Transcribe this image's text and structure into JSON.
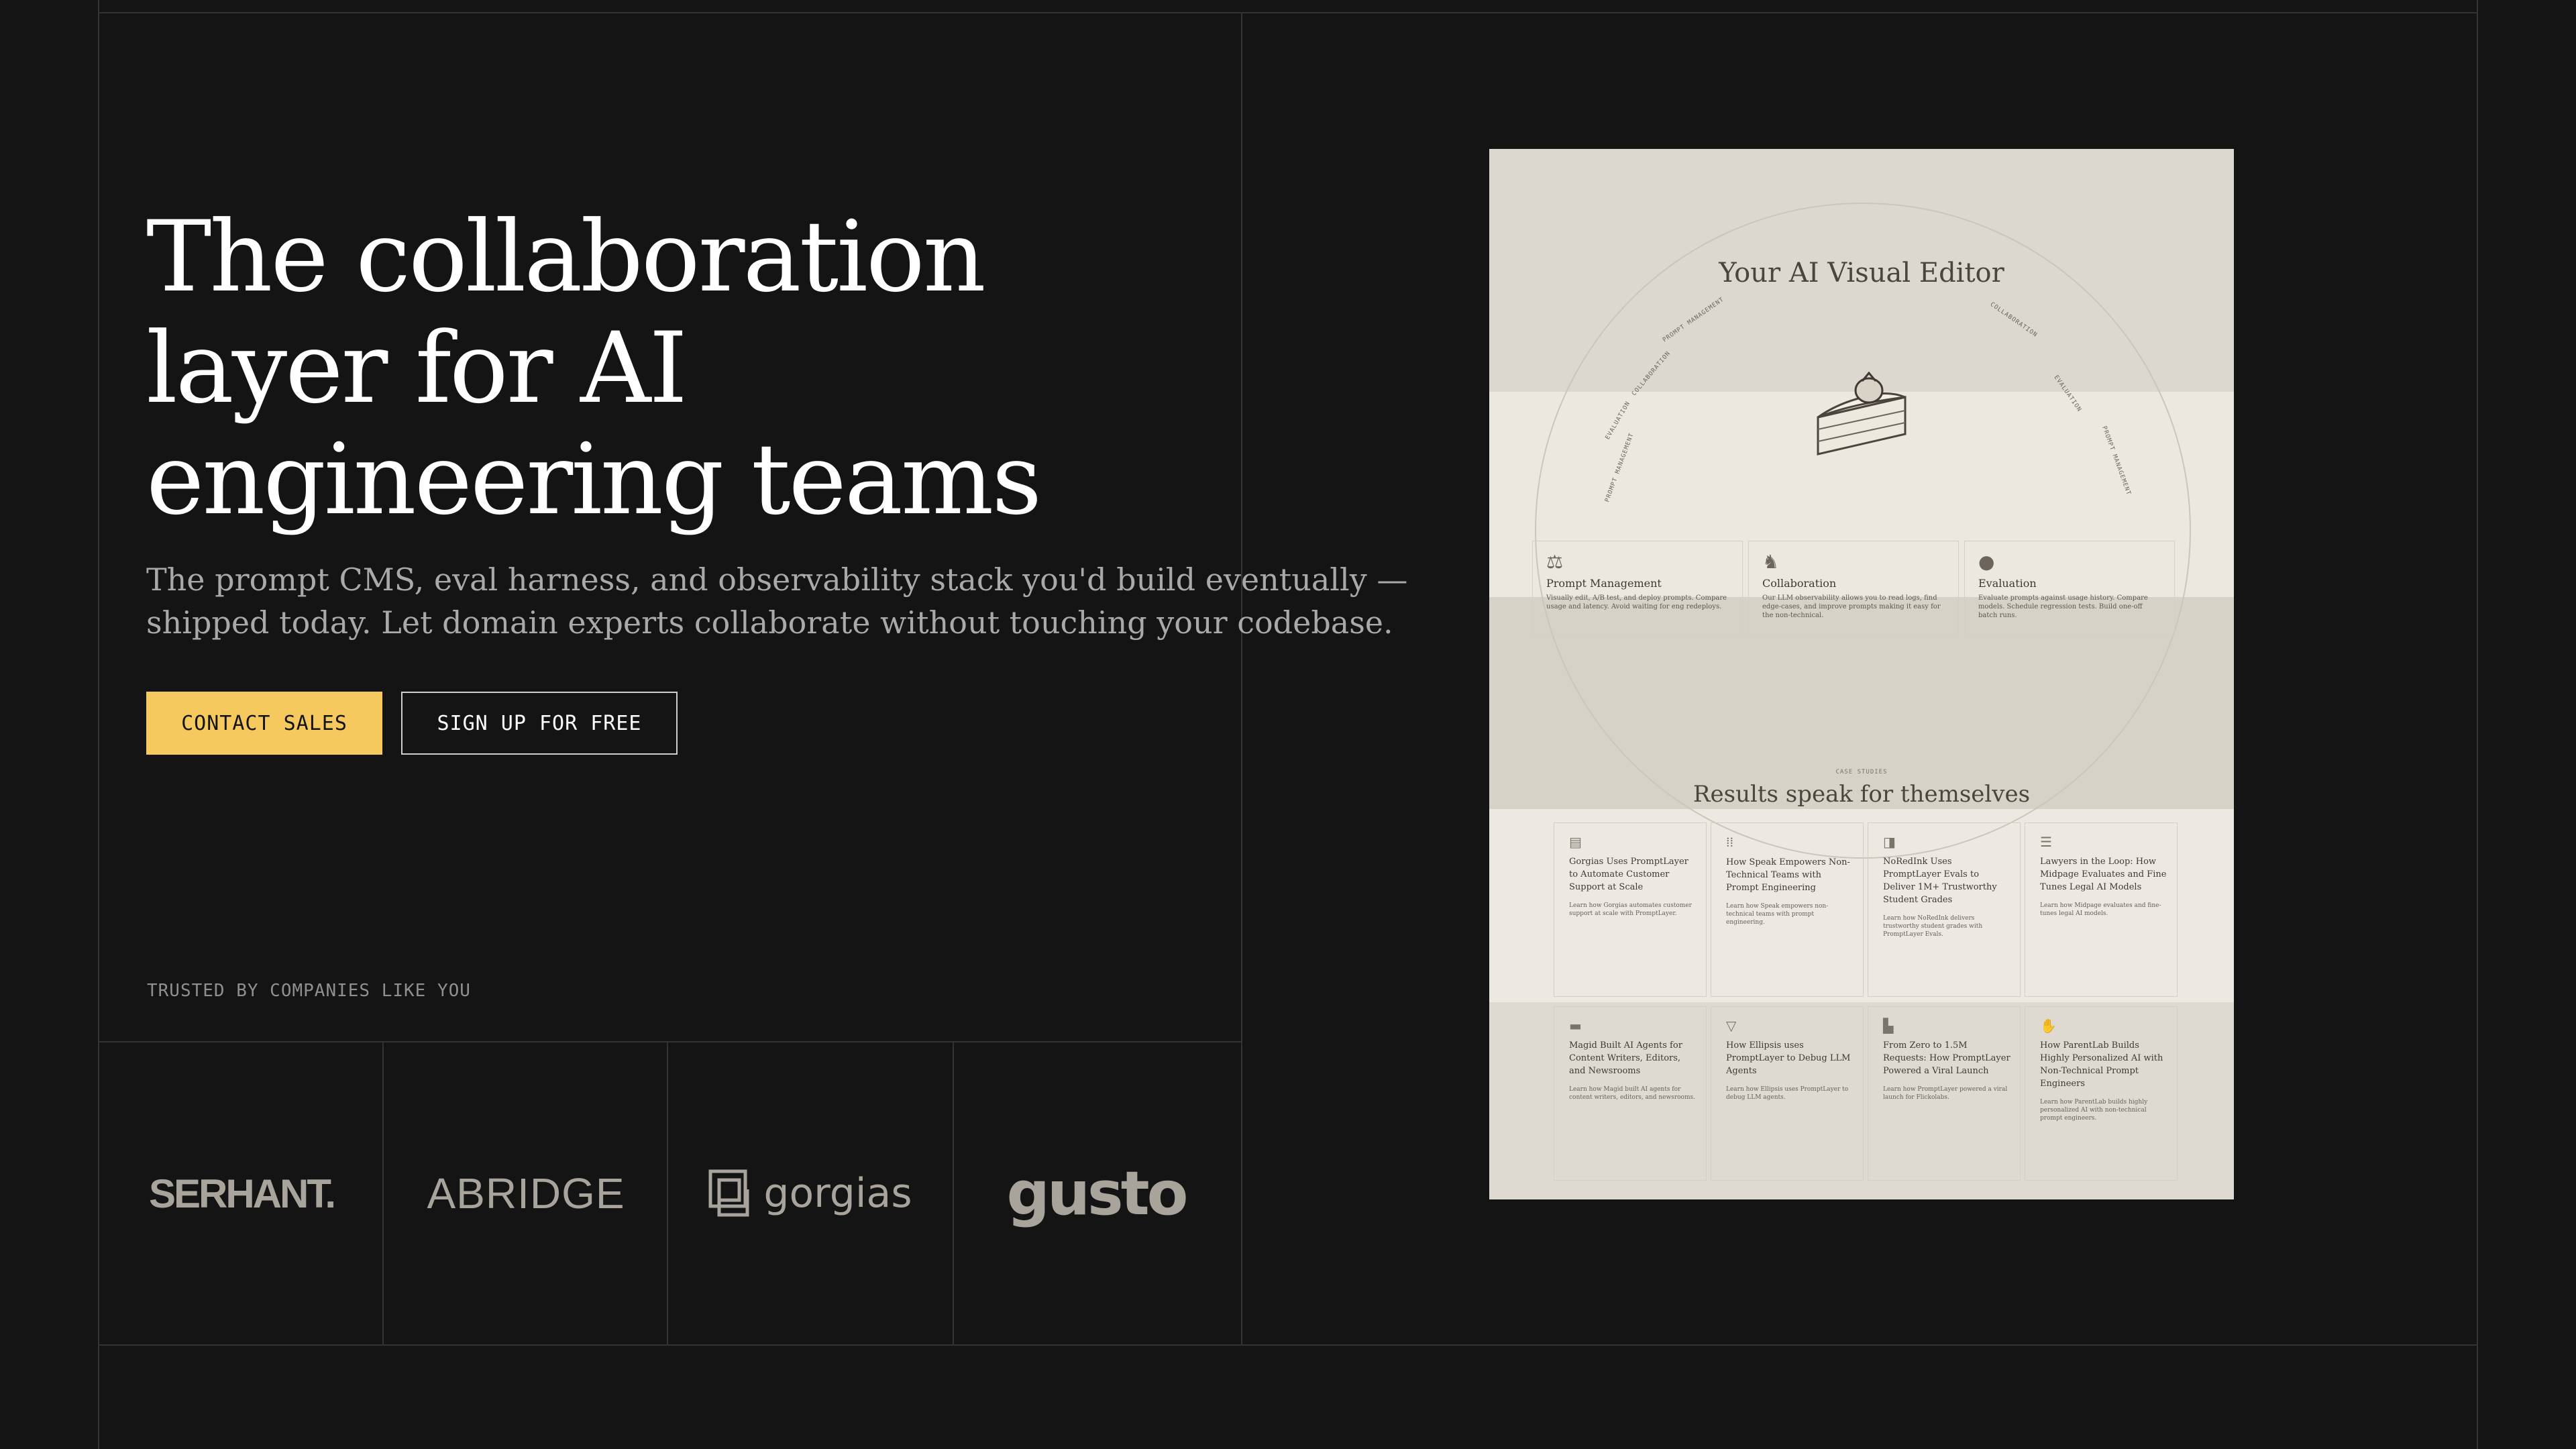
{
  "hero": {
    "title_lines": [
      "The collaboration",
      "layer for AI",
      "engineering teams"
    ],
    "subtitle_lines": [
      "The prompt CMS, eval harness, and observability stack you'd build eventually —",
      "shipped today. Let domain experts collaborate without touching your codebase."
    ],
    "primary_button": "CONTACT SALES",
    "secondary_button": "SIGN UP FOR FREE"
  },
  "trusted": {
    "label": "TRUSTED BY COMPANIES LIKE YOU",
    "logos": [
      "SERHANT.",
      "ABRIDGE",
      "gorgias",
      "gusto"
    ]
  },
  "preview": {
    "title": "Your AI Visual Editor",
    "arc_labels": [
      "PROMPT MANAGEMENT",
      "EVALUATION",
      "COLLABORATION",
      "PROMPT MANAGEMENT",
      "COLLABORATION",
      "EVALUATION",
      "PROMPT MANAGEMENT"
    ],
    "features": [
      {
        "name": "Prompt Management",
        "desc": "Visually edit, A/B test, and deploy prompts. Compare usage and latency. Avoid waiting for eng redeploys.",
        "icon": "scale-icon"
      },
      {
        "name": "Collaboration",
        "desc": "Our LLM observability allows you to read logs, find edge-cases, and improve prompts making it easy for the non-technical.",
        "icon": "rocking-horse-icon"
      },
      {
        "name": "Evaluation",
        "desc": "Evaluate prompts against usage history. Compare models. Schedule regression tests. Build one-off batch runs.",
        "icon": "globe-icon"
      }
    ],
    "case_tag": "CASE STUDIES",
    "results_title": "Results speak for themselves",
    "cases": [
      {
        "title": "Gorgias Uses PromptLayer to Automate Customer Support at Scale",
        "desc": "Learn how Gorgias automates customer support at scale with PromptLayer.",
        "icon": "document-icon"
      },
      {
        "title": "How Speak Empowers Non-Technical Teams with Prompt Engineering",
        "desc": "Learn how Speak empowers non-technical teams with prompt engineering.",
        "icon": "waveform-icon"
      },
      {
        "title": "NoRedInk Uses PromptLayer Evals to Deliver 1M+ Trustworthy Student Grades",
        "desc": "Learn how NoRedInk delivers trustworthy student grades with PromptLayer Evals.",
        "icon": "square-icon"
      },
      {
        "title": "Lawyers in the Loop: How Midpage Evaluates and Fine Tunes Legal AI Models",
        "desc": "Learn how Midpage evaluates and fine-tunes legal AI models.",
        "icon": "lines-icon"
      },
      {
        "title": "Magid Built AI Agents for Content Writers, Editors, and Newsrooms",
        "desc": "Learn how Magid built AI agents for content writers, editors, and newsrooms.",
        "icon": "box-icon"
      },
      {
        "title": "How Ellipsis uses PromptLayer to Debug LLM Agents",
        "desc": "Learn how Ellipsis uses PromptLayer to debug LLM agents.",
        "icon": "triangle-icon"
      },
      {
        "title": "From Zero to 1.5M Requests: How PromptLayer Powered a Viral Launch",
        "desc": "Learn how PromptLayer powered a viral launch for Flickolabs.",
        "icon": "bars-icon"
      },
      {
        "title": "How ParentLab Builds Highly Personalized AI with Non-Technical Prompt Engineers",
        "desc": "Learn how ParentLab builds highly personalized AI with non-technical prompt engineers.",
        "icon": "hand-icon"
      }
    ]
  }
}
